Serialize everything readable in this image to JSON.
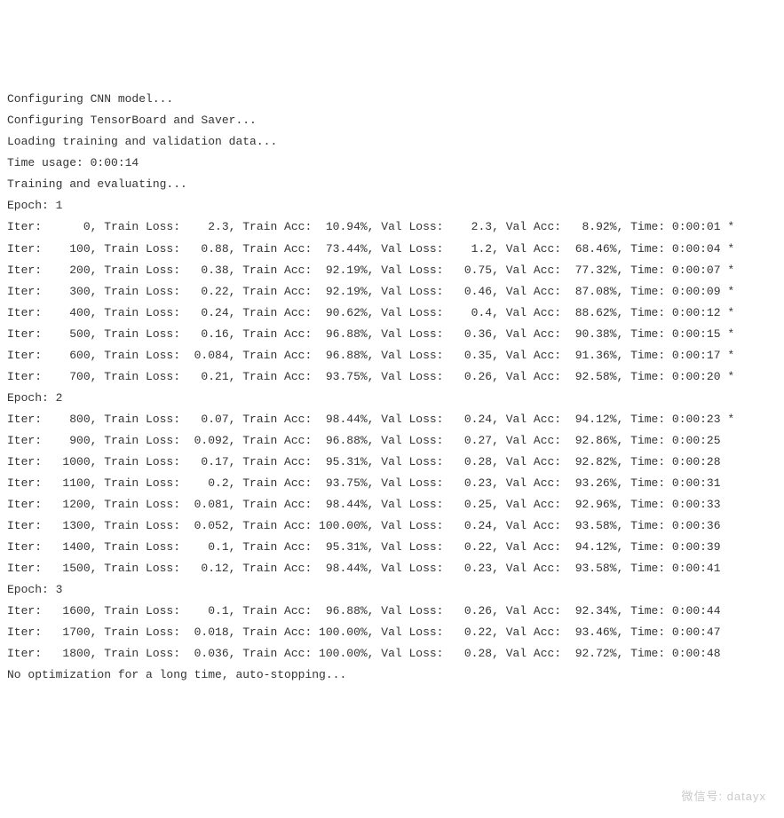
{
  "header_lines": [
    "Configuring CNN model...",
    "Configuring TensorBoard and Saver...",
    "Loading training and validation data...",
    "Time usage: 0:00:14",
    "Training and evaluating..."
  ],
  "epochs": [
    {
      "label": "Epoch: 1",
      "iters": [
        {
          "iter": "0",
          "train_loss": "2.3",
          "train_acc": "10.94%",
          "val_loss": "2.3",
          "val_acc": "8.92%",
          "time": "0:00:01",
          "star": true
        },
        {
          "iter": "100",
          "train_loss": "0.88",
          "train_acc": "73.44%",
          "val_loss": "1.2",
          "val_acc": "68.46%",
          "time": "0:00:04",
          "star": true
        },
        {
          "iter": "200",
          "train_loss": "0.38",
          "train_acc": "92.19%",
          "val_loss": "0.75",
          "val_acc": "77.32%",
          "time": "0:00:07",
          "star": true
        },
        {
          "iter": "300",
          "train_loss": "0.22",
          "train_acc": "92.19%",
          "val_loss": "0.46",
          "val_acc": "87.08%",
          "time": "0:00:09",
          "star": true
        },
        {
          "iter": "400",
          "train_loss": "0.24",
          "train_acc": "90.62%",
          "val_loss": "0.4",
          "val_acc": "88.62%",
          "time": "0:00:12",
          "star": true
        },
        {
          "iter": "500",
          "train_loss": "0.16",
          "train_acc": "96.88%",
          "val_loss": "0.36",
          "val_acc": "90.38%",
          "time": "0:00:15",
          "star": true
        },
        {
          "iter": "600",
          "train_loss": "0.084",
          "train_acc": "96.88%",
          "val_loss": "0.35",
          "val_acc": "91.36%",
          "time": "0:00:17",
          "star": true
        },
        {
          "iter": "700",
          "train_loss": "0.21",
          "train_acc": "93.75%",
          "val_loss": "0.26",
          "val_acc": "92.58%",
          "time": "0:00:20",
          "star": true
        }
      ]
    },
    {
      "label": "Epoch: 2",
      "iters": [
        {
          "iter": "800",
          "train_loss": "0.07",
          "train_acc": "98.44%",
          "val_loss": "0.24",
          "val_acc": "94.12%",
          "time": "0:00:23",
          "star": true
        },
        {
          "iter": "900",
          "train_loss": "0.092",
          "train_acc": "96.88%",
          "val_loss": "0.27",
          "val_acc": "92.86%",
          "time": "0:00:25",
          "star": false
        },
        {
          "iter": "1000",
          "train_loss": "0.17",
          "train_acc": "95.31%",
          "val_loss": "0.28",
          "val_acc": "92.82%",
          "time": "0:00:28",
          "star": false
        },
        {
          "iter": "1100",
          "train_loss": "0.2",
          "train_acc": "93.75%",
          "val_loss": "0.23",
          "val_acc": "93.26%",
          "time": "0:00:31",
          "star": false
        },
        {
          "iter": "1200",
          "train_loss": "0.081",
          "train_acc": "98.44%",
          "val_loss": "0.25",
          "val_acc": "92.96%",
          "time": "0:00:33",
          "star": false
        },
        {
          "iter": "1300",
          "train_loss": "0.052",
          "train_acc": "100.00%",
          "val_loss": "0.24",
          "val_acc": "93.58%",
          "time": "0:00:36",
          "star": false
        },
        {
          "iter": "1400",
          "train_loss": "0.1",
          "train_acc": "95.31%",
          "val_loss": "0.22",
          "val_acc": "94.12%",
          "time": "0:00:39",
          "star": false
        },
        {
          "iter": "1500",
          "train_loss": "0.12",
          "train_acc": "98.44%",
          "val_loss": "0.23",
          "val_acc": "93.58%",
          "time": "0:00:41",
          "star": false
        }
      ]
    },
    {
      "label": "Epoch: 3",
      "iters": [
        {
          "iter": "1600",
          "train_loss": "0.1",
          "train_acc": "96.88%",
          "val_loss": "0.26",
          "val_acc": "92.34%",
          "time": "0:00:44",
          "star": false
        },
        {
          "iter": "1700",
          "train_loss": "0.018",
          "train_acc": "100.00%",
          "val_loss": "0.22",
          "val_acc": "93.46%",
          "time": "0:00:47",
          "star": false
        },
        {
          "iter": "1800",
          "train_loss": "0.036",
          "train_acc": "100.00%",
          "val_loss": "0.28",
          "val_acc": "92.72%",
          "time": "0:00:48",
          "star": false
        }
      ]
    }
  ],
  "footer_line": "No optimization for a long time, auto-stopping...",
  "watermark": "微信号: datayx"
}
